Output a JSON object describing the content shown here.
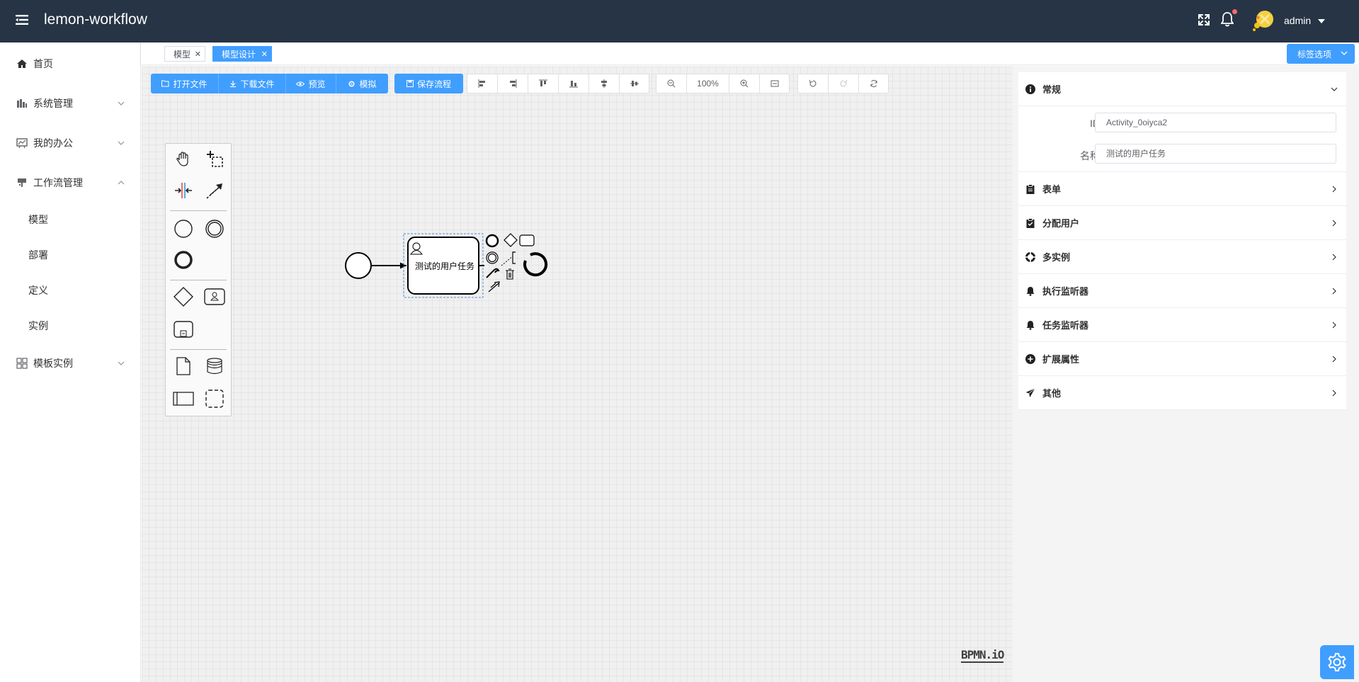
{
  "header": {
    "app_title": "lemon-workflow",
    "user_name": "admin"
  },
  "sidebar": {
    "items": [
      {
        "label": "首页"
      },
      {
        "label": "系统管理"
      },
      {
        "label": "我的办公"
      },
      {
        "label": "工作流管理"
      },
      {
        "label": "模板实例"
      }
    ],
    "workflow_children": [
      {
        "label": "模型"
      },
      {
        "label": "部署"
      },
      {
        "label": "定义"
      },
      {
        "label": "实例"
      }
    ]
  },
  "tags": {
    "items": [
      {
        "label": "模型"
      },
      {
        "label": "模型设计"
      }
    ],
    "options_label": "标签选项"
  },
  "toolbar": {
    "open_file": "打开文件",
    "download_file": "下载文件",
    "preview": "预览",
    "simulate": "模拟",
    "save_process": "保存流程",
    "zoom_level": "100%"
  },
  "diagram": {
    "user_task_label": "测试的用户任务",
    "logo": "BPMN.iO"
  },
  "properties": {
    "general": {
      "title": "常规",
      "id_label": "ID",
      "id_value": "Activity_0oiyca2",
      "name_label": "名称",
      "name_value": "测试的用户任务"
    },
    "sections": [
      {
        "title": "表单"
      },
      {
        "title": "分配用户"
      },
      {
        "title": "多实例"
      },
      {
        "title": "执行监听器"
      },
      {
        "title": "任务监听器"
      },
      {
        "title": "扩展属性"
      },
      {
        "title": "其他"
      }
    ]
  },
  "colors": {
    "header_bg": "#263445",
    "primary": "#409eff"
  }
}
